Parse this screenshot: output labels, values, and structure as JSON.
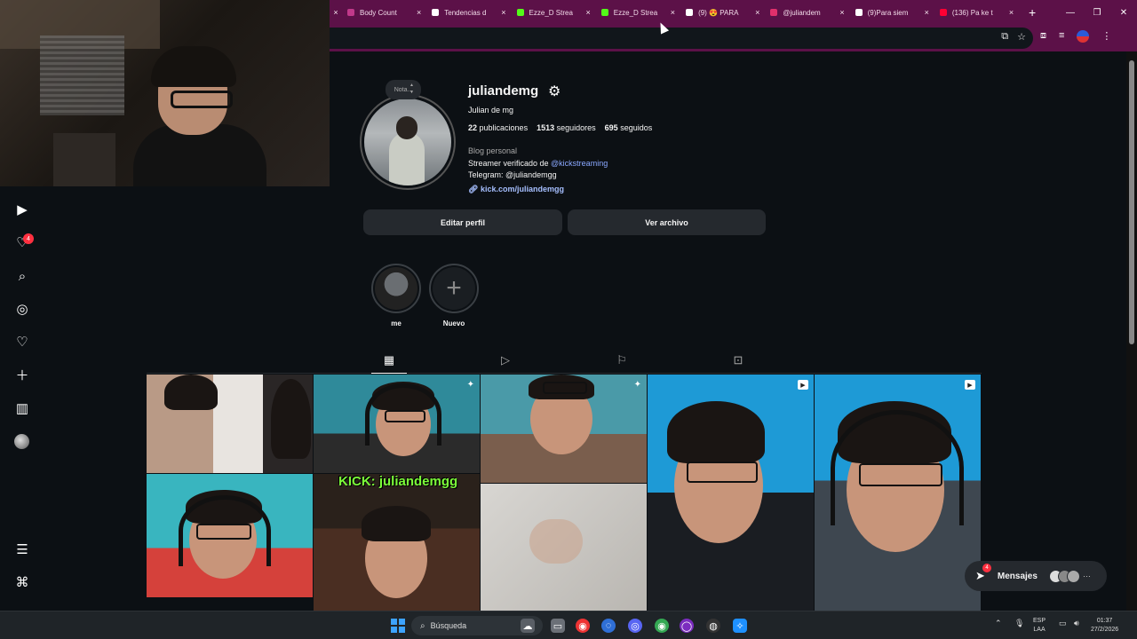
{
  "browser": {
    "tabs": [
      {
        "label": "Body Count",
        "color": "#c0398a"
      },
      {
        "label": "Tendencias d",
        "color": "#ffffff"
      },
      {
        "label": "Ezze_D Strea",
        "color": "#53fc18"
      },
      {
        "label": "Ezze_D Strea",
        "color": "#53fc18"
      },
      {
        "label": "(9) 😍 PARA",
        "color": "#ffffff"
      },
      {
        "label": "@juliandem",
        "color": "#e1306c"
      },
      {
        "label": "(9)Para siem",
        "color": "#ffffff"
      },
      {
        "label": "(136) Pa ke t",
        "color": "#ff0033"
      }
    ],
    "close_glyph": "×",
    "new_tab_glyph": "+",
    "window_controls": [
      "—",
      "❐",
      "✕"
    ]
  },
  "profile": {
    "username": "juliandemg",
    "full_name": "Julian de mg",
    "note_placeholder": "Nota...",
    "stats": {
      "posts": "22",
      "posts_label": "publicaciones",
      "followers": "1513",
      "followers_label": "seguidores",
      "following": "695",
      "following_label": "seguidos"
    },
    "category": "Blog personal",
    "bio_line1_prefix": "Streamer verificado de ",
    "bio_line1_mention": "@kickstreaming",
    "bio_line2": "Telegram: @juliandemgg",
    "link": "kick.com/juliandemgg",
    "edit_button": "Editar perfil",
    "archive_button": "Ver archivo"
  },
  "highlights": [
    {
      "label": "me"
    },
    {
      "label": "Nuevo"
    }
  ],
  "grid": {
    "kick_caption": "KICK: juliandemgg"
  },
  "nav": {
    "notifications_badge": "4"
  },
  "messages": {
    "label": "Mensajes",
    "badge": "4"
  },
  "taskbar": {
    "search_placeholder": "Búsqueda",
    "lang_top": "ESP",
    "lang_bottom": "LAA",
    "time": "01:37",
    "date": "27/2/2026"
  }
}
